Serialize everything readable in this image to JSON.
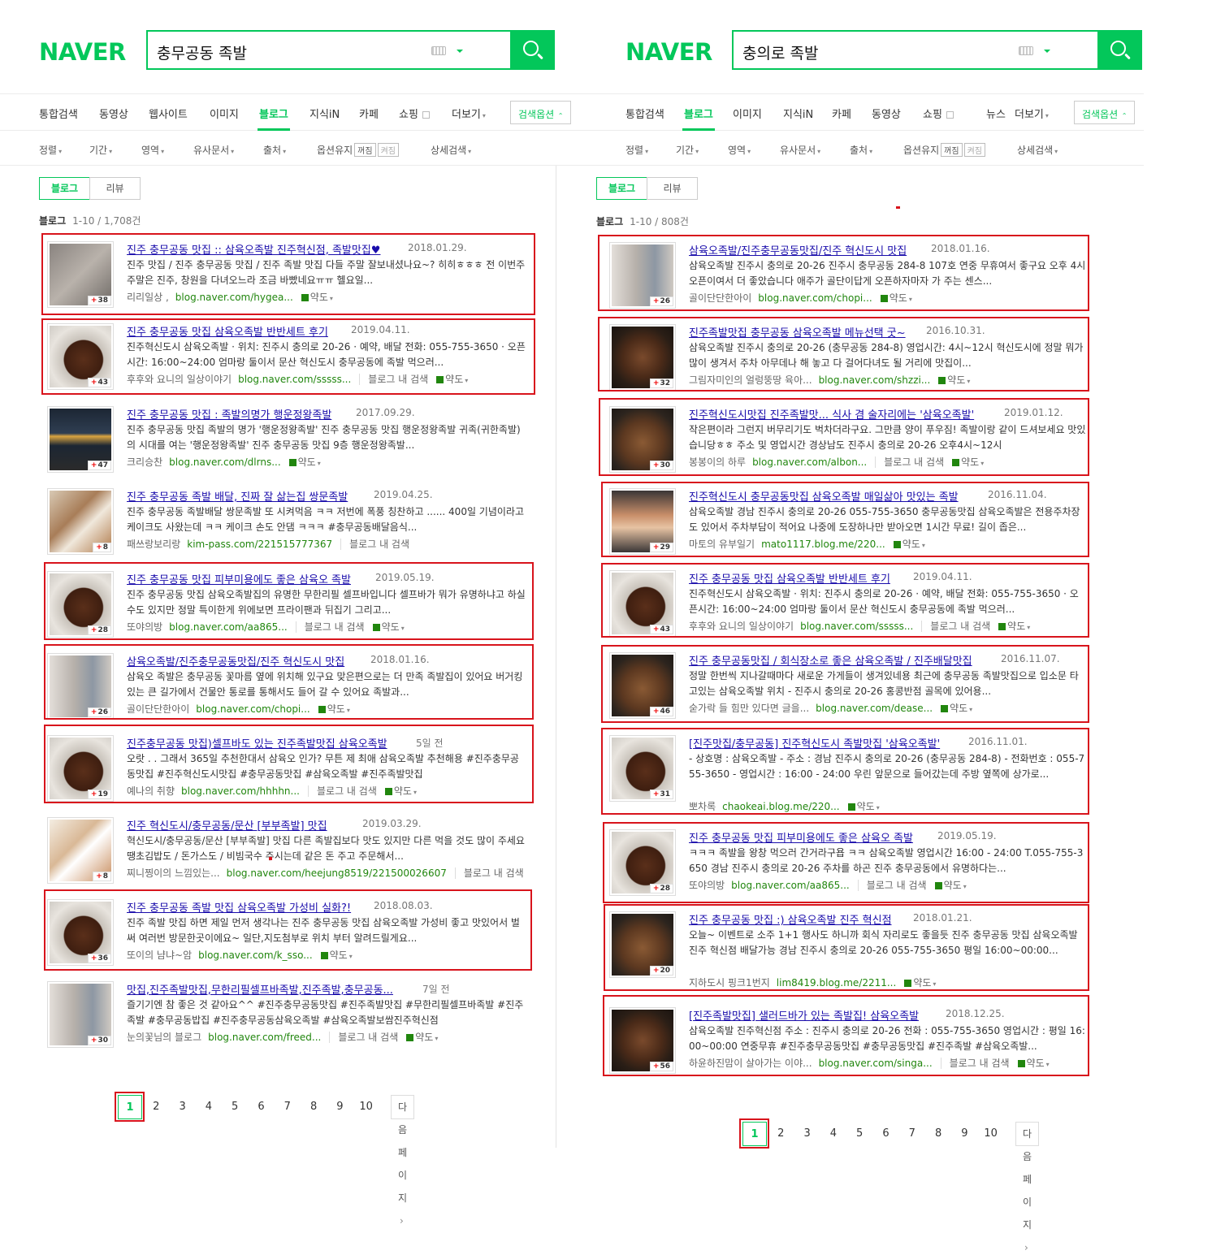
{
  "left": {
    "logo": "NAVER",
    "query": "충무공동 족발",
    "tabs": [
      "통합검색",
      "동영상",
      "웹사이트",
      "이미지",
      "블로그",
      "지식iN",
      "카페",
      "쇼핑",
      "더보기"
    ],
    "option_btn": "검색옵션",
    "filters": {
      "sort": "정렬",
      "period": "기간",
      "area": "영역",
      "similar": "유사문서",
      "source": "출처",
      "keep": "옵션유지",
      "off": "꺼짐",
      "on": "켜짐",
      "detail": "상세검색"
    },
    "subtabs": [
      "블로그",
      "리뷰"
    ],
    "count_label": "블로그",
    "count": "1-10 / 1,708건",
    "items": [
      {
        "title": "진주 충무공동 맛집 :: 삼육오족발 진주혁신점, 족발맛집♥",
        "date": "2018.01.29.",
        "desc": "진주 맛집 / 진주 충무공동 맛집 / 진주 족발 맛집 다들 주말 잘보내셨나요~? 히히ㅎㅎㅎ 전 이번주 주말은 진주, 창원을 다녀오느라 조금 바빴네요ㅠㅠ 헬요일...",
        "author": "리리일상 ,",
        "url": "blog.naver.com/hygea...",
        "bs": "",
        "tr": "약도",
        "badge": "38",
        "img": "t1"
      },
      {
        "title": "진주 충무공동 맛집 삼육오족발 반반세트 후기",
        "date": "2019.04.11.",
        "desc": "진주혁신도시 삼육오족발 · 위치: 진주시 충의로 20-26 · 예약, 배달 전화: 055-755-3650 · 오픈시간: 16:00~24:00 엄마랑 둘이서 문산 혁신도시 충무공동에 족발 먹으러...",
        "author": "후후와 요니의 일상이야기",
        "url": "blog.naver.com/sssss...",
        "bs": "블로그 내 검색",
        "tr": "약도",
        "badge": "43",
        "img": "t2"
      },
      {
        "title": "진주 충무공동 맛집 : 족발의명가 행운정왕족발",
        "date": "2017.09.29.",
        "desc": "진주 충무공동 맛집 족발의 명가 '행운정왕족발' 진주 충무공동 맛집 행운정왕족발 귀족(귀한족발)의 시대를 여는 '행운정왕족발' 진주 충무공동 맛집 9층 행운정왕족발...",
        "author": "크리승찬",
        "url": "blog.naver.com/dlrns...",
        "bs": "",
        "tr": "약도",
        "badge": "47",
        "img": "t3"
      },
      {
        "title": "진주 충무공동 족발 배달, 진짜 잘 삶는집 쌍문족발",
        "date": "2019.04.25.",
        "desc": "진주 충무공동 족발배달 쌍문족발 또 시켜먹음 ㅋㅋ 저번에 폭풍 칭찬하고 ...... 400일 기념이라고 케이크도 사왔는데 ㅋㅋ 케이크 손도 안댐 ㅋㅋㅋ #충무공동배달음식...",
        "author": "패쓰랑보리랑",
        "url": "kim-pass.com/221515777367",
        "bs": "블로그 내 검색",
        "tr": "",
        "badge": "8",
        "img": "t4"
      },
      {
        "title": "진주 충무공동 맛집 피부미용에도 좋은 삼육오 족발",
        "date": "2019.05.19.",
        "desc": "진주 충무공동 맛집 삼육오족발집의 유명한 무한리필 셀프바입니다 셀프바가 뭐가 유명하냐고 하실수도 있지만 정말 특이한게 위에보면 프라이팬과 뒤집기 그리고...",
        "author": "또야의방",
        "url": "blog.naver.com/aa865...",
        "bs": "블로그 내 검색",
        "tr": "약도",
        "badge": "28",
        "img": "t2"
      },
      {
        "title": "삼육오족발/진주충무공동맛집/진주 혁신도시 맛집",
        "date": "2018.01.16.",
        "desc": "삼육오 족발은 충무공동 꽃마름 옆에 위치해 있구요 맞은편으로는 더 만족 족발집이 있어요 버거킹 있는 큰 길가에서 건물안 통로를 통해서도 들어 갈 수 있어요 족발과...",
        "author": "골이단단한아이",
        "url": "blog.naver.com/chopi...",
        "bs": "",
        "tr": "약도",
        "badge": "26",
        "img": "t5"
      },
      {
        "title": "진주충무공동 맛집)셀프바도 있는 진주족발맛집 삼육오족발",
        "date": "5일 전",
        "desc": "오랏 . . 그래서 365일 추천한대서 삼육오 인가? 무튼 제 최애 삼육오족발 추천해용 #진주충무공동맛집 #진주혁신도시맛집 #충무공동맛집 #삼육오족발 #진주족발맛집",
        "author": "예나의 취향",
        "url": "blog.naver.com/hhhhn...",
        "bs": "블로그 내 검색",
        "tr": "약도",
        "badge": "19",
        "img": "t2"
      },
      {
        "title": "진주 혁신도시/충무공동/문산 [부부족발] 맛집",
        "date": "2019.03.29.",
        "desc": "혁신도시/충무공동/문산 [부부족발] 맛집 다른 족발집보다 맛도 있지만 다른 먹을 것도 많이 주세요 땡초김밥도 / 돈가스도 / 비빔국수 주시는데 같은 돈 주고 주문해서...",
        "author": "찌니찡이의 느낌있는...",
        "url": "blog.naver.com/heejung8519/221500026607",
        "bs": "블로그 내 검색",
        "tr": "",
        "badge": "8",
        "img": "t6"
      },
      {
        "title": "진주 충무공동 족발 맛집 삼육오족발 가성비 실화?!",
        "date": "2018.08.03.",
        "desc": "진주 족발 맛집 하면 제일 먼저 생각나는 진주 충무공동 맛집 삼육오족발 가성비 좋고 맛있어서 벌써 여러번 방문한곳이에요~ 일단,지도첨부로 위치 부터 알려드릴게요...",
        "author": "또이의 냠냐~암",
        "url": "blog.naver.com/k_sso...",
        "bs": "",
        "tr": "약도",
        "badge": "36",
        "img": "t2"
      },
      {
        "title": "맛집,진주족발맛집,무한리필셀프바족발,진주족발,충무공동...",
        "date": "7일 전",
        "desc": "즐기기엔 참 좋은 것 같아요^^ #진주충무공동맛집 #진주족발맛집 #무한리필셀프바족발 #진주족발 #충무공동밥집 #진주충무공동삼육오족발 #삼육오족발보쌈진주혁신점",
        "author": "눈의꽃님의 블로그",
        "url": "blog.naver.com/freed...",
        "bs": "블로그 내 검색",
        "tr": "약도",
        "badge": "30",
        "img": "t5"
      }
    ],
    "pages": [
      "1",
      "2",
      "3",
      "4",
      "5",
      "6",
      "7",
      "8",
      "9",
      "10"
    ],
    "next": "다음페이지"
  },
  "right": {
    "logo": "NAVER",
    "query": "충의로 족발",
    "tabs": [
      "통합검색",
      "블로그",
      "이미지",
      "지식iN",
      "카페",
      "동영상",
      "쇼핑",
      "뉴스",
      "더보기"
    ],
    "option_btn": "검색옵션",
    "filters": {
      "sort": "정렬",
      "period": "기간",
      "area": "영역",
      "similar": "유사문서",
      "source": "출처",
      "keep": "옵션유지",
      "off": "꺼짐",
      "on": "켜짐",
      "detail": "상세검색"
    },
    "subtabs": [
      "블로그",
      "리뷰"
    ],
    "count_label": "블로그",
    "count": "1-10 / 808건",
    "items": [
      {
        "title": "삼육오족발/진주충무공동맛집/진주 혁신도시 맛집",
        "date": "2018.01.16.",
        "desc": "삼육오족발 진주시 충의로 20-26 진주시 충무공동 284-8 107호 연중 무휴여서 좋구요 오후 4시 오픈이여서 더 좋았습니다 애주가 골단이답게 오픈하자마자 가 주는 센스...",
        "author": "골이단단한아이",
        "url": "blog.naver.com/chopi...",
        "bs": "",
        "tr": "약도",
        "badge": "26",
        "img": "t5"
      },
      {
        "title": "진주족발맛집 충무공동 삼육오족발 메뉴선택 굿~",
        "date": "2016.10.31.",
        "desc": "삼육오족발 진주시 충의로 20-26 (충무공동 284-8) 영업시간: 4시~12시 혁신도시에 정말 뭐가 많이 생겨서 주차 아무데나 해 놓고 다 걸어다녀도 될 거리에 맛집이...",
        "author": "그림자미인의 얼렁뚱땅 육아...",
        "url": "blog.naver.com/shzzi...",
        "bs": "",
        "tr": "약도",
        "badge": "32",
        "img": "t7"
      },
      {
        "title": "진주혁신도시맛집 진주족발맛... 식사 겸 술자리에는 '삼육오족발'",
        "date": "2019.01.12.",
        "desc": "작은편이라 그런지 버무리기도 벅차더라구요. 그만큼 양이 푸우짐! 족발이랑 같이 드셔보세요 맛있습니당ㅎㅎ 주소 및 영업시간 경상남도 진주시 충의로 20-26 오후4시~12시",
        "author": "봉봉이의 하루",
        "url": "blog.naver.com/albon...",
        "bs": "블로그 내 검색",
        "tr": "약도",
        "badge": "30",
        "img": "t8"
      },
      {
        "title": "진주혁신도시 충무공동맛집 삼육오족발 매일삶아 맛있는 족발",
        "date": "2016.11.04.",
        "desc": "삼육오족발 경남 진주시 충의로 20-26 055-755-3650 충무공동맛집 삼육오족발은 전용주차장도 있어서 주차부담이 적어요 나중에 도장하나만 받아오면 1시간 무료! 길이 좁은...",
        "author": "마토의 유부일기",
        "url": "mato1117.blog.me/220...",
        "bs": "",
        "tr": "약도",
        "badge": "29",
        "img": "t9"
      },
      {
        "title": "진주 충무공동 맛집 삼육오족발 반반세트 후기",
        "date": "2019.04.11.",
        "desc": "진주혁신도시 삼육오족발 · 위치: 진주시 충의로 20-26 · 예약, 배달 전화: 055-755-3650 · 오픈시간: 16:00~24:00 엄마랑 둘이서 문산 혁신도시 충무공동에 족발 먹으러...",
        "author": "후후와 요니의 일상이야기",
        "url": "blog.naver.com/sssss...",
        "bs": "블로그 내 검색",
        "tr": "약도",
        "badge": "43",
        "img": "t2"
      },
      {
        "title": "진주 충무공동맛집 / 회식장소로 좋은 삼육오족발 / 진주배달맛집",
        "date": "2016.11.07.",
        "desc": "정말 한번씩 지나갈때마다 새로운 가게들이 생겨있네용 최근에 충무공동 족발맛집으로 입소문 타고있는 삼육오족발 위치 - 진주시 충의로 20-26 홍콩반점 골목에 있어용...",
        "author": "숟가락 들 힘만 있다면 글을...",
        "url": "blog.naver.com/dease...",
        "bs": "",
        "tr": "약도",
        "badge": "46",
        "img": "t8"
      },
      {
        "title": "[진주맛집/충무공동] 진주혁신도시 족발맛집 '삼육오족발'",
        "date": "2016.11.01.",
        "desc": "- 상호명 : 삼육오족발 - 주소 : 경남 진주시 충의로 20-26 (충무공동 284-8) - 전화번호 : 055-755-3650 - 영업시간 : 16:00 - 24:00 우린 앞문으로 들어갔는데 주방 옆쪽에 상가로...",
        "author": "뽀차록",
        "url": "chaokeai.blog.me/220...",
        "bs": "",
        "tr": "약도",
        "badge": "31",
        "img": "t2"
      },
      {
        "title": "진주 충무공동 맛집 피부미용에도 좋은 삼육오 족발",
        "date": "2019.05.19.",
        "desc": "ㅋㅋㅋ 족발을 왕창 먹으러 간거라구욥 ㅋㅋ 삼육오족발 영업시간 16:00 - 24:00 T.055-755-3650 경남 진주시 충의로 20-26 주차를 하곤 진주 충무공동에서 유명하다는...",
        "author": "또야의방",
        "url": "blog.naver.com/aa865...",
        "bs": "블로그 내 검색",
        "tr": "약도",
        "badge": "28",
        "img": "t2"
      },
      {
        "title": "진주 충무공동 맛집 :) 삼육오족발 진주 혁신점",
        "date": "2018.01.21.",
        "desc": "오늘~ 이벤트로 소주 1+1 행사도 하니까 회식 자리로도 좋을듯 진주 충무공동 맛집 삼육오족발 진주 혁신점 배달가능 경남 진주시 충의로 20-26 055-755-3650 평일 16:00~00:00...",
        "author": "지하도시 핑크1번지",
        "url": "lim8419.blog.me/2211...",
        "bs": "",
        "tr": "약도",
        "badge": "20",
        "img": "t8"
      },
      {
        "title": "[진주족발맛집] 샐러드바가 있는 족발집! 삼육오족발",
        "date": "2018.12.25.",
        "desc": "삼육오족발 진주혁신점 주소 : 진주시 충의로 20-26 전화 : 055-755-3650 영업시간 : 평일 16:00~00:00 연중무휴 #진주충무공동맛집 #충무공동맛집 #진주족발 #삼육오족발...",
        "author": "하윤하진맘이 살아가는 이야...",
        "url": "blog.naver.com/singa...",
        "bs": "블로그 내 검색",
        "tr": "약도",
        "badge": "56",
        "img": "t7"
      }
    ],
    "pages": [
      "1",
      "2",
      "3",
      "4",
      "5",
      "6",
      "7",
      "8",
      "9",
      "10"
    ],
    "next": "다음페이지"
  },
  "colors": {
    "naver_green": "#03c75a",
    "highlight_red": "#d8141c",
    "link_blue": "#1a0dab",
    "url_green": "#21860e"
  },
  "icons": [
    "search-icon",
    "keyboard-icon",
    "caret-down-icon",
    "caret-up-icon",
    "map-icon",
    "plus-icon"
  ]
}
